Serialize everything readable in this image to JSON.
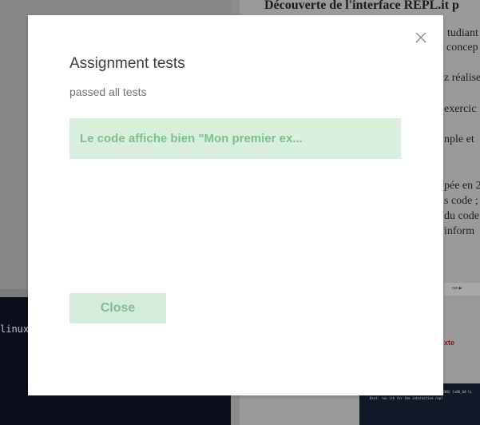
{
  "background": {
    "doc_title": "Découverte de l'interface REPL.it p",
    "doc_lines": [
      "tudiant",
      "concep",
      "z réalise",
      "exercic",
      "nple et",
      "pée en 2",
      "s code ;",
      "du code",
      "inform"
    ],
    "terminal_text": "linux",
    "strip_text": "run ▶",
    "red_word": "xte",
    "mini_terminal_lines": [
      "ruby 2.5.5p157 (2019-03-15 revision 67260) [x86_64-li",
      "Hint: run irb for the interactive repl"
    ]
  },
  "modal": {
    "title": "Assignment tests",
    "subtitle": "passed all tests",
    "tests": [
      {
        "text": "Le code affiche bien \"Mon premier ex...",
        "status": "passed"
      }
    ],
    "close_button_label": "Close",
    "close_icon": "close-icon"
  },
  "colors": {
    "pass_bg": "#d8efdd",
    "pass_text": "#7ebf8e",
    "button_bg": "#d4ecda",
    "button_text": "#84bc92"
  }
}
